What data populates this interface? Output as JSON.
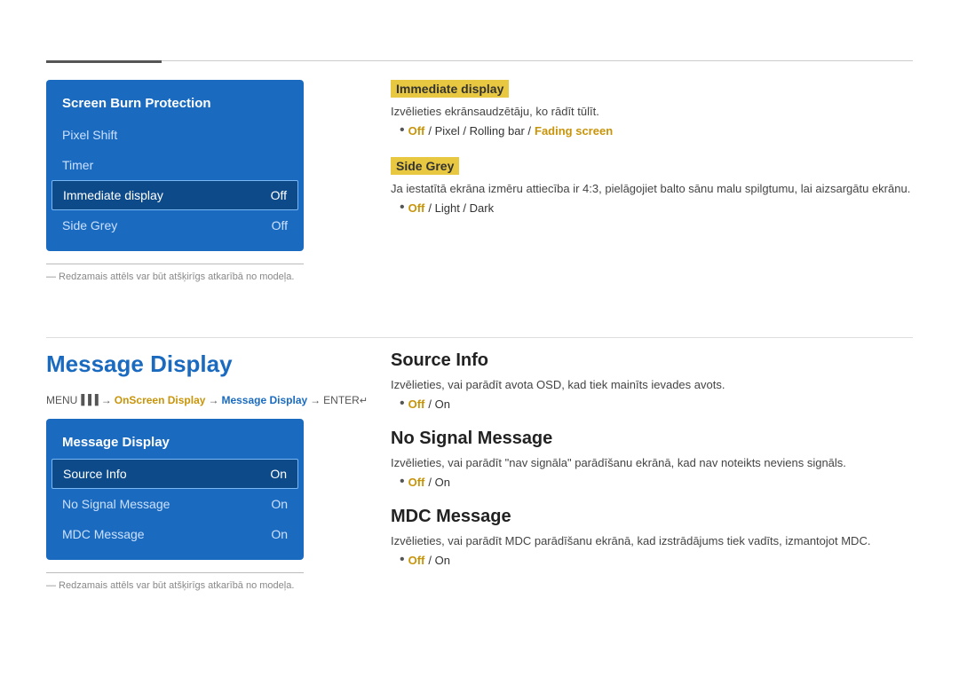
{
  "top_divider": true,
  "screen_burn": {
    "title": "Screen Burn Protection",
    "items": [
      {
        "label": "Pixel Shift",
        "value": "",
        "active": false
      },
      {
        "label": "Timer",
        "value": "",
        "active": false
      },
      {
        "label": "Immediate display",
        "value": "Off",
        "active": true
      },
      {
        "label": "Side Grey",
        "value": "Off",
        "active": false
      }
    ],
    "footnote": "― Redzamais attēls var būt atšķirīgs atkarībā no modeļa."
  },
  "immediate_display": {
    "label": "Immediate display",
    "desc": "Izvēlieties ekrānsaudzētāju, ko rādīt tūlīt.",
    "options_prefix": "Off",
    "options": "/ Pixel / Rolling bar / Fading screen",
    "options_accent": "Off"
  },
  "side_grey": {
    "label": "Side Grey",
    "desc": "Ja iestatītā ekrāna izmēru attiecība ir 4:3, pielāgojiet balto sānu malu spilgtumu, lai aizsargātu ekrānu.",
    "options_prefix": "Off",
    "options": "/ Light / Dark",
    "options_accent": "Off"
  },
  "message_display": {
    "heading": "Message Display",
    "breadcrumb": [
      {
        "text": "MENU",
        "type": "normal"
      },
      {
        "text": " → ",
        "type": "arrow"
      },
      {
        "text": "OnScreen Display",
        "type": "accent"
      },
      {
        "text": " → ",
        "type": "arrow"
      },
      {
        "text": "Message Display",
        "type": "active"
      },
      {
        "text": " → ",
        "type": "arrow"
      },
      {
        "text": "ENTER",
        "type": "normal"
      }
    ],
    "menu_title": "Message Display",
    "items": [
      {
        "label": "Source Info",
        "value": "On",
        "active": true
      },
      {
        "label": "No Signal Message",
        "value": "On",
        "active": false
      },
      {
        "label": "MDC Message",
        "value": "On",
        "active": false
      }
    ],
    "footnote": "― Redzamais attēls var būt atšķirīgs atkarībā no modeļa."
  },
  "source_info": {
    "title": "Source Info",
    "desc": "Izvēlieties, vai parādīt avota OSD, kad tiek mainīts ievades avots.",
    "options_accent": "Off",
    "options": "/ On"
  },
  "no_signal_message": {
    "title": "No Signal Message",
    "desc": "Izvēlieties, vai parādīt \"nav signāla\" parādīšanu ekrānā, kad nav noteikts neviens signāls.",
    "options_accent": "Off",
    "options": "/ On"
  },
  "mdc_message": {
    "title": "MDC Message",
    "desc": "Izvēlieties, vai parādīt MDC parādīšanu ekrānā, kad izstrādājums tiek vadīts, izmantojot MDC.",
    "options_accent": "Off",
    "options": "/ On"
  }
}
